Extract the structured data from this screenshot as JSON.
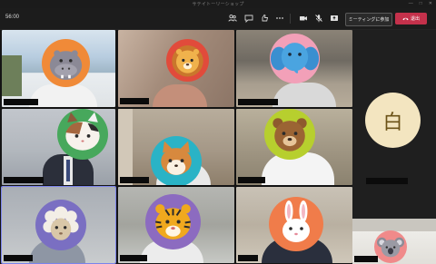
{
  "window": {
    "title": "サテイトーリーショップ"
  },
  "toolbar": {
    "timer": "56:00",
    "join_label": "ミーティングに参加",
    "leave_label": "退出"
  },
  "participants": {
    "right_avatar_initial": "白"
  },
  "colors": {
    "leave": "#c4314b",
    "accent": "#7b83eb",
    "avatar_bg": "#f3e5c0"
  }
}
